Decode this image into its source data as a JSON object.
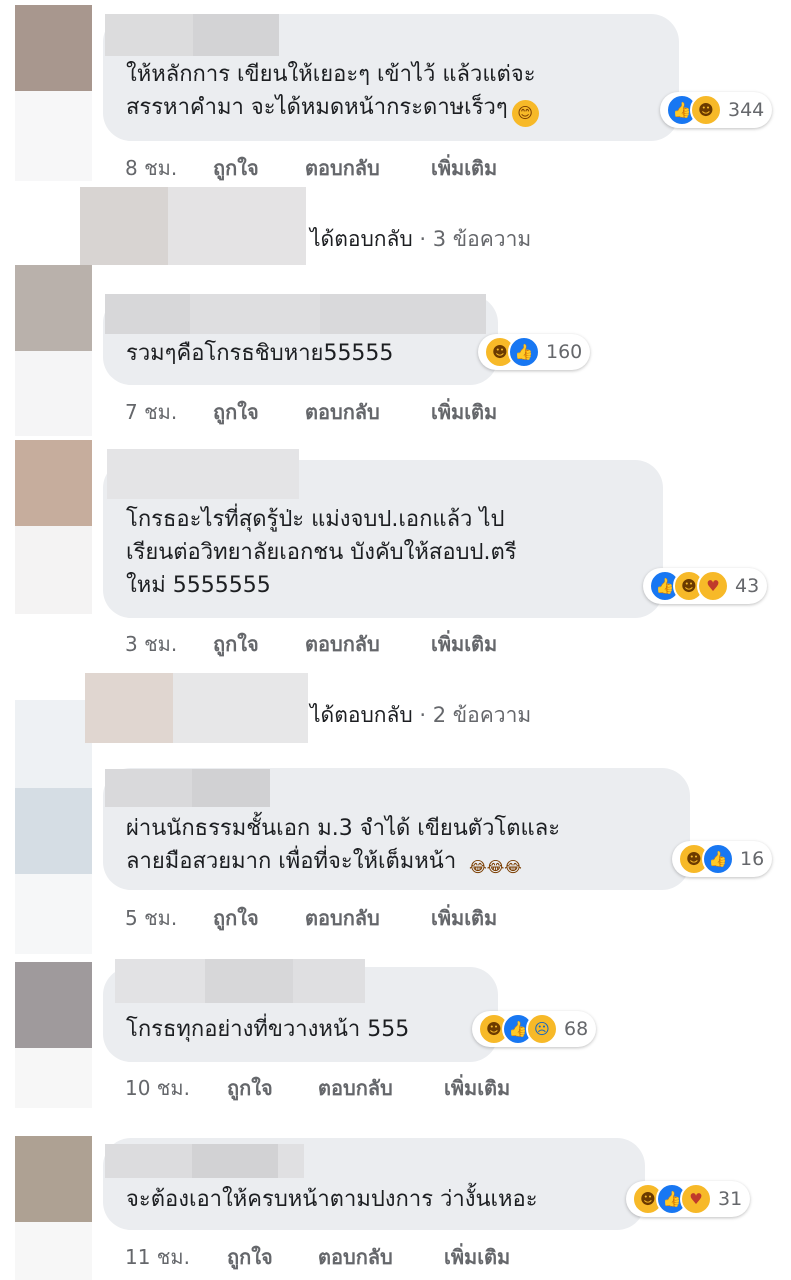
{
  "comments": [
    {
      "text_lines": [
        "ให้หลักการ เขียนให้เยอะๆ เข้าไว้ แล้วแต่จะ",
        "สรรหาคำมา จะได้หมดหน้ากระดาษเร็วๆ"
      ],
      "emoji": "😊",
      "reactions": [
        "like-icon",
        "haha-icon"
      ],
      "reaction_count": "344",
      "time": "8 ชม.",
      "like": "ถูกใจ",
      "reply": "ตอบกลับ",
      "more": "เพิ่มเติม",
      "avatar_color": "#a8978e"
    },
    {
      "text_lines": [
        "รวมๆคือโกรธชิบหาย55555"
      ],
      "reactions": [
        "haha-icon",
        "like-icon"
      ],
      "reaction_count": "160",
      "time": "7 ชม.",
      "like": "ถูกใจ",
      "reply": "ตอบกลับ",
      "more": "เพิ่มเติม",
      "avatar_color": "#b9b1ab"
    },
    {
      "text_lines": [
        "โกรธอะไรที่สุดรู้ป่ะ แม่งจบป.เอกแล้ว ไป",
        "เรียนต่อวิทยาลัยเอกชน บังคับให้สอบป.ตรี",
        "ใหม่ 5555555"
      ],
      "reactions": [
        "like-icon",
        "haha-icon",
        "care-icon"
      ],
      "reaction_count": "43",
      "time": "3 ชม.",
      "like": "ถูกใจ",
      "reply": "ตอบกลับ",
      "more": "เพิ่มเติม",
      "avatar_color": "#c6ad9d"
    },
    {
      "text_lines": [
        "ผ่านนักธรรมชั้นเอก ม.3 จำได้ เขียนตัวโตและ",
        "ลายมือสวยมาก เพื่อที่จะให้เต็มหน้า"
      ],
      "emoji": "😂😂😂",
      "reactions": [
        "haha-icon",
        "like-icon"
      ],
      "reaction_count": "16",
      "time": "5 ชม.",
      "like": "ถูกใจ",
      "reply": "ตอบกลับ",
      "more": "เพิ่มเติม",
      "avatar_color": "#d5dde4"
    },
    {
      "text_lines": [
        "โกรธทุกอย่างที่ขวางหน้า 555"
      ],
      "reactions": [
        "haha-icon",
        "like-icon",
        "sad-icon"
      ],
      "reaction_count": "68",
      "time": "10 ชม.",
      "like": "ถูกใจ",
      "reply": "ตอบกลับ",
      "more": "เพิ่มเติม",
      "avatar_color": "#9f9a9c"
    },
    {
      "text_lines": [
        "จะต้องเอาให้ครบหน้าตามปงการ ว่างั้นเหอะ"
      ],
      "reactions": [
        "haha-icon",
        "like-icon",
        "care-icon"
      ],
      "reaction_count": "31",
      "time": "11 ชม.",
      "like": "ถูกใจ",
      "reply": "ตอบกลับ",
      "more": "เพิ่มเติม",
      "avatar_color": "#aea193"
    }
  ],
  "reply_threads": [
    {
      "label": "ได้ตอบกลับ",
      "count": "· 3 ข้อความ"
    },
    {
      "label": "ได้ตอบกลับ",
      "count": "· 2 ข้อความ"
    }
  ],
  "colors": {
    "bubble": "#ebedf0",
    "meta_text": "#65676b",
    "like_blue": "#1877f2",
    "haha_yellow": "#f7b928"
  }
}
